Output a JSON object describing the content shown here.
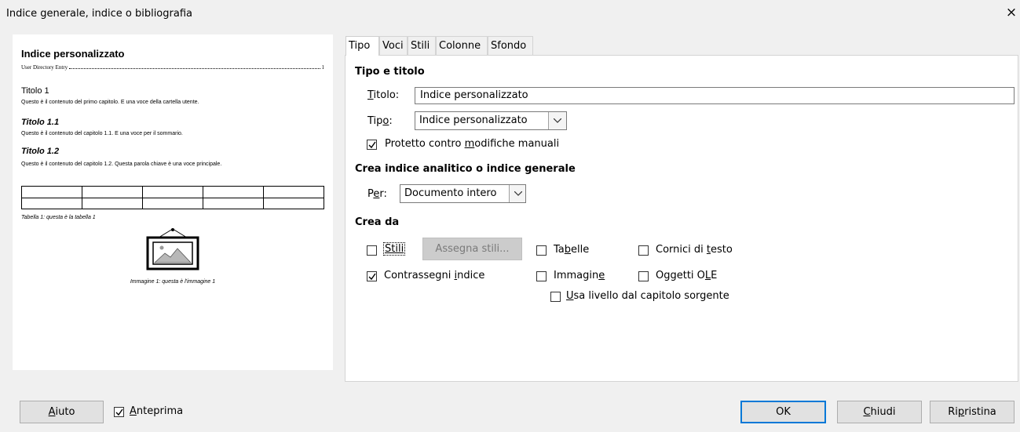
{
  "window": {
    "title": "Indice generale, indice o bibliografia",
    "close_glyph": "×"
  },
  "preview": {
    "heading": "Indice personalizzato",
    "entry_label": "User Directory Entry",
    "entry_page": "1",
    "titolo1": "Titolo 1",
    "titolo1_text": "Questo è il contenuto del primo capitolo. E una voce della cartella utente.",
    "titolo11": "Titolo 1.1",
    "titolo11_text": "Questo è il contenuto del capitolo 1.1. E una voce per il sommario.",
    "titolo12": "Titolo 1.2",
    "titolo12_text": "Questo è il contenuto del capitolo 1.2. Questa parola chiave è una voce principale.",
    "table_caption": "Tabella 1: questa è la tabella 1",
    "image_caption": "Immagine 1: questa è l'immagine 1",
    "image_icon": "framed-picture-icon"
  },
  "tabs": [
    "Tipo",
    "Voci",
    "Stili",
    "Colonne",
    "Sfondo"
  ],
  "active_tab": "Tipo",
  "tipo_e_titolo": {
    "section": "Tipo e titolo",
    "titolo_label_u": "T",
    "titolo_label_rest": "itolo:",
    "titolo_value": "Indice personalizzato",
    "tipo_label_pre": "Tip",
    "tipo_label_u": "o",
    "tipo_label_post": ":",
    "tipo_value": "Indice personalizzato",
    "protetto_pre": "Protetto contro ",
    "protetto_u": "m",
    "protetto_post": "odifiche manuali",
    "protetto_checked": true
  },
  "crea_indice": {
    "section": "Crea indice analitico o indice generale",
    "per_pre": "P",
    "per_u": "e",
    "per_post": "r:",
    "per_value": "Documento intero"
  },
  "crea_da": {
    "section": "Crea da",
    "stili_label": "Stili",
    "stili_checked": false,
    "assegna_stili": "Assegna stili...",
    "tabelle_pre": "Ta",
    "tabelle_u": "b",
    "tabelle_post": "elle",
    "tabelle_checked": false,
    "cornici_pre": "Cornici di ",
    "cornici_u": "t",
    "cornici_post": "esto",
    "cornici_checked": false,
    "contrassegni_pre": "Contrassegni ",
    "contrassegni_u": "i",
    "contrassegni_post": "ndice",
    "contrassegni_checked": true,
    "immagine_pre": "Immagin",
    "immagine_u": "e",
    "immagine_post": "",
    "immagine_checked": false,
    "oggetti_pre": "Oggetti O",
    "oggetti_u": "L",
    "oggetti_post": "E",
    "oggetti_checked": false,
    "usa_u": "U",
    "usa_post": "sa livello dal capitolo sorgente",
    "usa_checked": false
  },
  "footer": {
    "aiuto_u": "A",
    "aiuto_post": "iuto",
    "anteprima_u": "A",
    "anteprima_post": "nteprima",
    "anteprima_checked": true,
    "ok": "OK",
    "chiudi_u": "C",
    "chiudi_post": "hiudi",
    "ripristina_pre": "Ri",
    "ripristina_u": "p",
    "ripristina_post": "ristina"
  }
}
